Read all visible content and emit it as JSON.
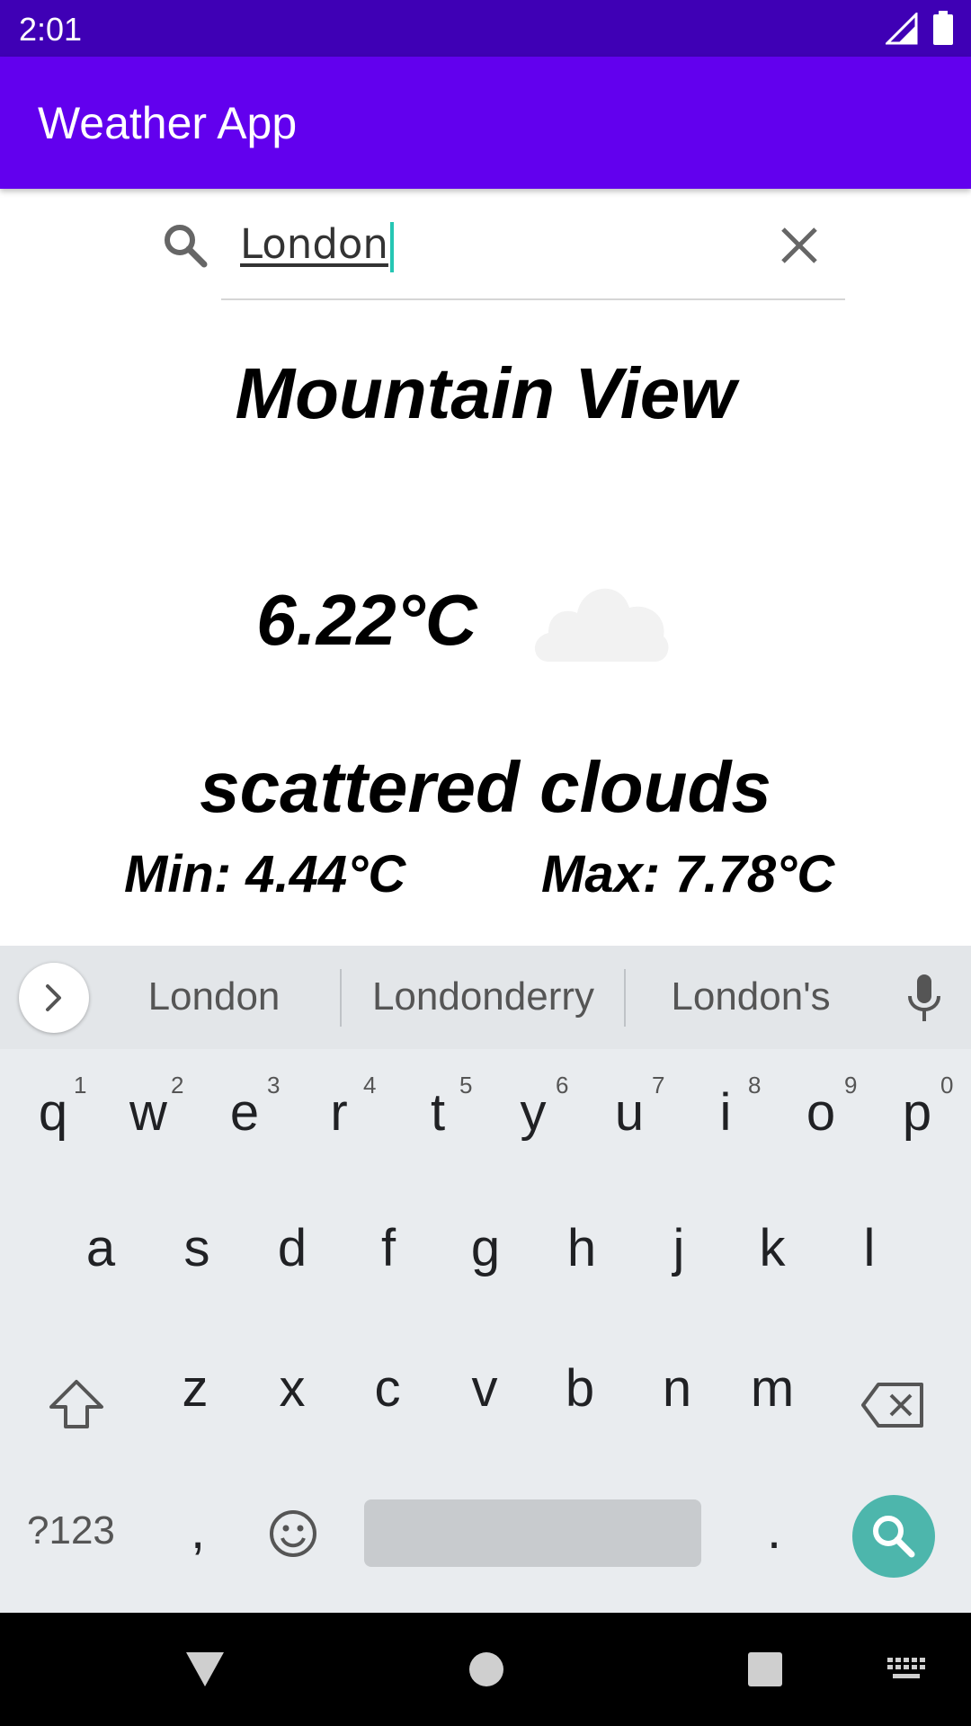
{
  "status_bar": {
    "time": "2:01"
  },
  "app_bar": {
    "title": "Weather App"
  },
  "search": {
    "query": "London"
  },
  "weather": {
    "city": "Mountain View",
    "temperature": "6.22°C",
    "description": "scattered clouds",
    "min": "Min: 4.44°C",
    "max": "Max: 7.78°C",
    "icon": "cloud-icon"
  },
  "keyboard": {
    "suggestions": [
      "London",
      "Londonderry",
      "London's"
    ],
    "row1": [
      "q",
      "w",
      "e",
      "r",
      "t",
      "y",
      "u",
      "i",
      "o",
      "p"
    ],
    "row1_hints": [
      "1",
      "2",
      "3",
      "4",
      "5",
      "6",
      "7",
      "8",
      "9",
      "0"
    ],
    "row2": [
      "a",
      "s",
      "d",
      "f",
      "g",
      "h",
      "j",
      "k",
      "l"
    ],
    "row3": [
      "z",
      "x",
      "c",
      "v",
      "b",
      "n",
      "m"
    ],
    "symbols_label": "?123",
    "comma": ",",
    "period": "."
  },
  "colors": {
    "status_bar": "#3f00b5",
    "app_bar": "#6200ee",
    "accent": "#4db6ac"
  }
}
